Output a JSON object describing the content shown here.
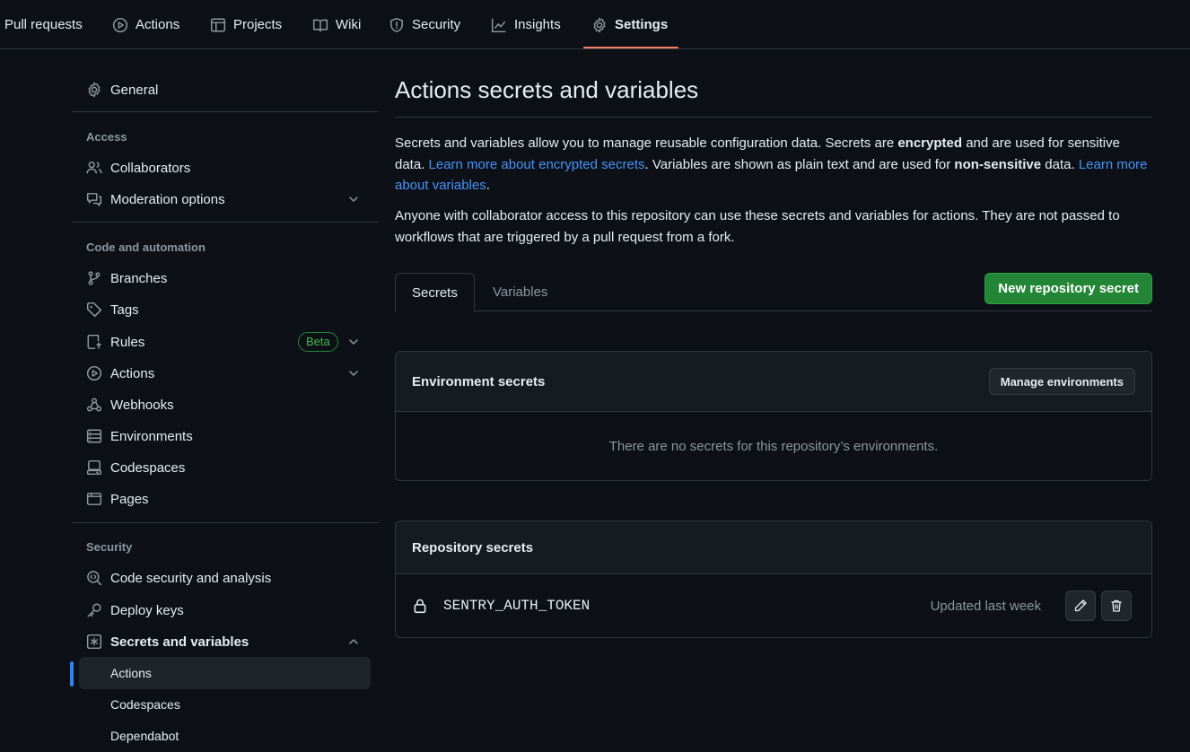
{
  "nav": {
    "tabs": [
      {
        "label": "Pull requests"
      },
      {
        "label": "Actions"
      },
      {
        "label": "Projects"
      },
      {
        "label": "Wiki"
      },
      {
        "label": "Security"
      },
      {
        "label": "Insights"
      },
      {
        "label": "Settings"
      }
    ],
    "selected": "Settings",
    "accent_color": "#f78166"
  },
  "sidebar": {
    "general": "General",
    "headings": {
      "access": "Access",
      "code_automation": "Code and automation",
      "security": "Security"
    },
    "access_items": [
      "Collaborators",
      "Moderation options"
    ],
    "code_items": [
      "Branches",
      "Tags",
      "Rules",
      "Actions",
      "Webhooks",
      "Environments",
      "Codespaces",
      "Pages"
    ],
    "rules_badge": "Beta",
    "security_items": [
      "Code security and analysis",
      "Deploy keys",
      "Secrets and variables"
    ],
    "secrets_sub_items": [
      "Actions",
      "Codespaces",
      "Dependabot"
    ],
    "active_sub_item": "Actions"
  },
  "main": {
    "title": "Actions secrets and variables",
    "intro": {
      "p1_a": "Secrets and variables allow you to manage reusable configuration data. Secrets are ",
      "p1_b": "encrypted",
      "p1_c": " and are used for sensitive data. ",
      "p1_link1": "Learn more about encrypted secrets",
      "p1_d": ". Variables are shown as plain text and are used for ",
      "p1_e": "non-sensitive",
      "p1_f": " data. ",
      "p1_link2": "Learn more about variables",
      "p1_g": ".",
      "p2": "Anyone with collaborator access to this repository can use these secrets and variables for actions. They are not passed to workflows that are triggered by a pull request from a fork."
    },
    "tabs": {
      "secrets": "Secrets",
      "variables": "Variables",
      "selected": "Secrets"
    },
    "new_secret_button": "New repository secret",
    "environment_secrets": {
      "title": "Environment secrets",
      "manage_button": "Manage environments",
      "empty_message": "There are no secrets for this repository’s environments."
    },
    "repository_secrets": {
      "title": "Repository secrets",
      "items": [
        {
          "name": "SENTRY_AUTH_TOKEN",
          "updated": "Updated last week"
        }
      ]
    }
  },
  "colors": {
    "background": "#0d1117",
    "link": "#4493f8",
    "primary_button": "#238636",
    "active_indicator": "#2f81f7",
    "beta_badge": "#3fb950"
  }
}
